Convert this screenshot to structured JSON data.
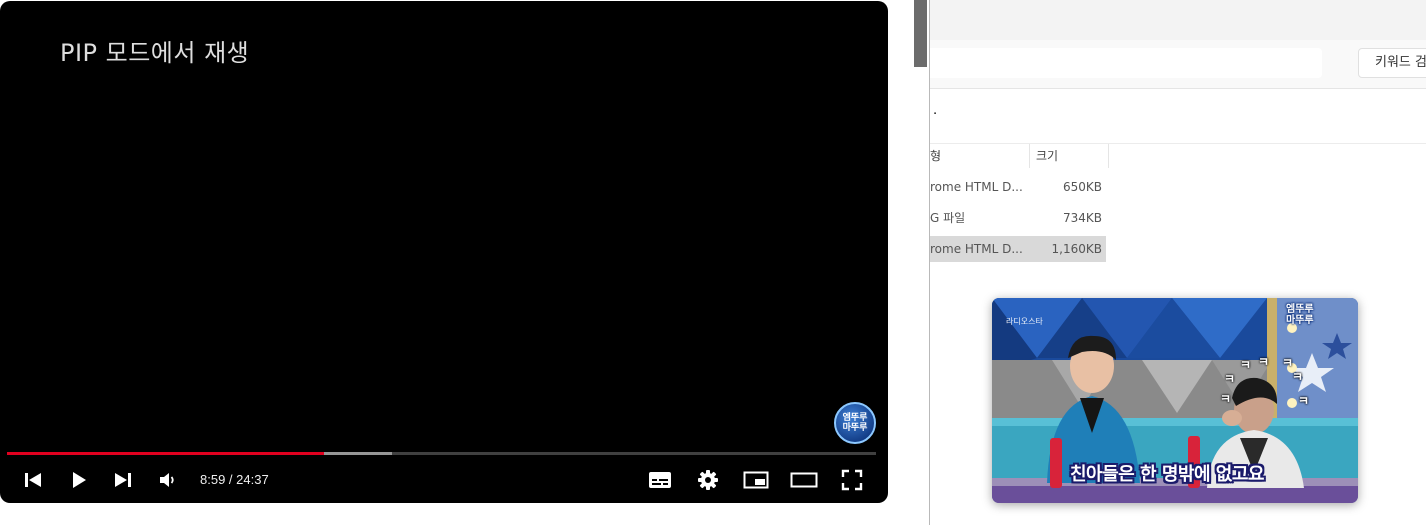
{
  "player": {
    "pip_message": "PIP 모드에서 재생",
    "watermark_text_line1": "엠뚜루",
    "watermark_text_line2": "마뚜루",
    "current_time": "8:59",
    "duration": "24:37",
    "time_display": "8:59 / 24:37",
    "progress_played": 0.365,
    "progress_buffered": 0.443,
    "colors": {
      "progress_played": "#e1001f",
      "background": "#000000"
    },
    "controls": [
      "prev-icon",
      "play-icon",
      "next-icon",
      "volume-icon",
      "subtitles-icon",
      "settings-icon",
      "miniplayer-icon",
      "theater-icon",
      "fullscreen-icon"
    ]
  },
  "explorer": {
    "search_label": "키워드 검",
    "path_text": ".",
    "columns": {
      "type": "형",
      "size": "크기"
    },
    "rows": [
      {
        "type": "rome HTML D...",
        "size": "650KB",
        "selected": false
      },
      {
        "type": "G 파일",
        "size": "734KB",
        "selected": false
      },
      {
        "type": "rome HTML D...",
        "size": "1,160KB",
        "selected": true
      }
    ]
  },
  "pip": {
    "caption": "친아들은 한 명밖에 없고요",
    "logo_line1": "엠뚜루",
    "logo_line2": "마뚜루",
    "show_logo": "라디오스타",
    "laugh": "ㅋ"
  }
}
